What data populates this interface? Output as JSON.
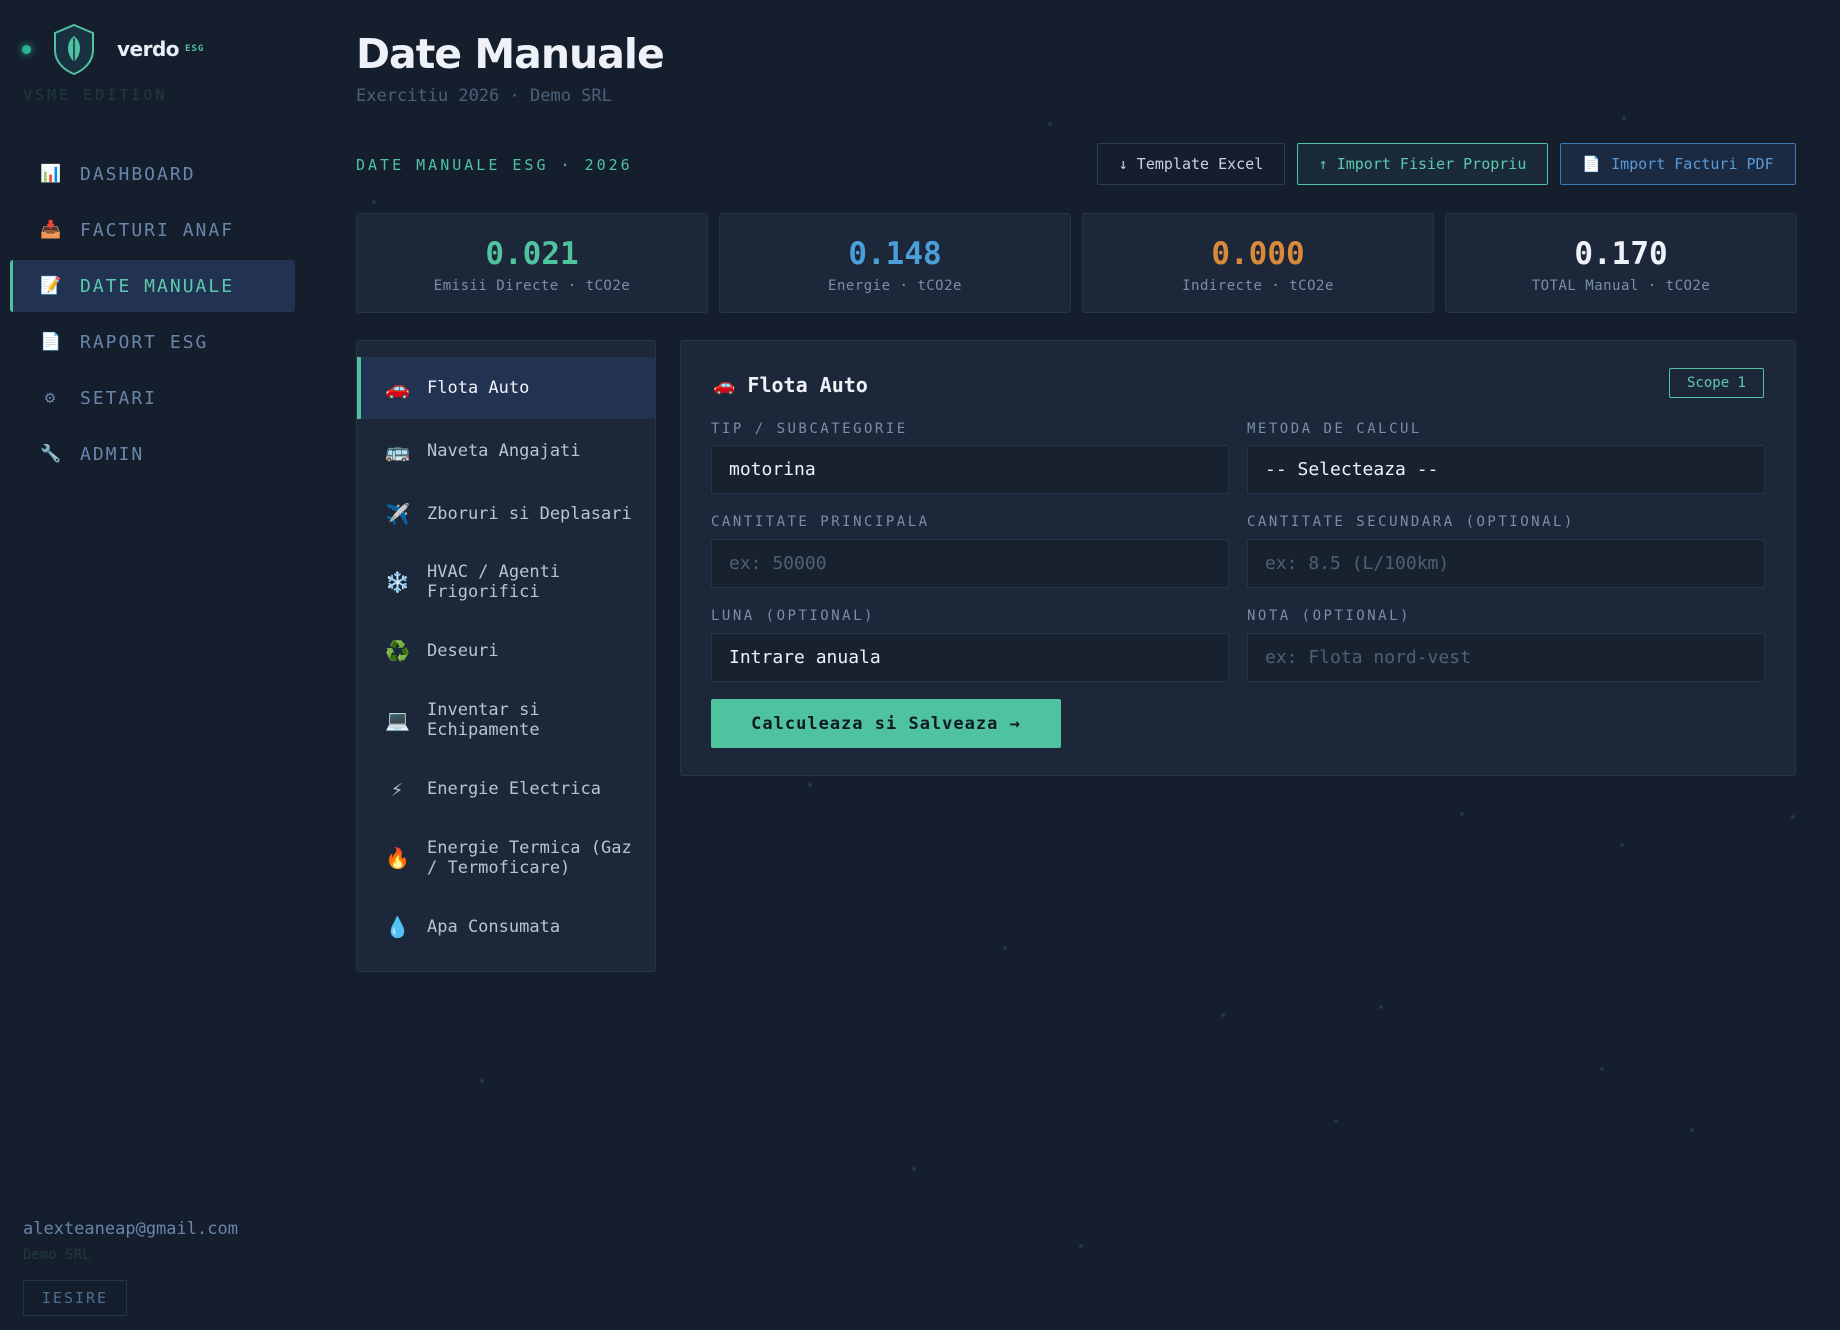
{
  "brand": {
    "name": "verdo",
    "sub": "ESG",
    "edition": "VSME EDITION"
  },
  "sidebar": {
    "items": [
      {
        "icon": "📊",
        "label": "DASHBOARD"
      },
      {
        "icon": "📥",
        "label": "FACTURI ANAF"
      },
      {
        "icon": "📝",
        "label": "DATE MANUALE"
      },
      {
        "icon": "📄",
        "label": "RAPORT ESG"
      },
      {
        "icon": "⚙",
        "label": "SETARI"
      },
      {
        "icon": "🔧",
        "label": "ADMIN"
      }
    ],
    "active_index": 2
  },
  "user": {
    "email": "alexteaneap@gmail.com",
    "company": "Demo SRL",
    "logout_label": "IESIRE"
  },
  "header": {
    "title": "Date Manuale",
    "subtitle": "Exercitiu 2026 · Demo SRL"
  },
  "section_label": "DATE MANUALE ESG · 2026",
  "actions": {
    "template_label": "↓ Template Excel",
    "import_label": "↑ Import Fisier Propriu",
    "pdf_icon": "📄",
    "pdf_label": "Import Facturi PDF"
  },
  "stats": [
    {
      "value": "0.021",
      "label": "Emisii Directe · tCO2e",
      "color": "#4fc2a0"
    },
    {
      "value": "0.148",
      "label": "Energie · tCO2e",
      "color": "#4a9fd8"
    },
    {
      "value": "0.000",
      "label": "Indirecte · tCO2e",
      "color": "#d8893a"
    },
    {
      "value": "0.170",
      "label": "TOTAL Manual · tCO2e",
      "color": "#eef2f8"
    }
  ],
  "categories": [
    {
      "icon": "🚗",
      "label": "Flota Auto"
    },
    {
      "icon": "🚌",
      "label": "Naveta Angajati"
    },
    {
      "icon": "✈️",
      "label": "Zboruri si Deplasari"
    },
    {
      "icon": "❄️",
      "label": "HVAC / Agenti Frigorifici"
    },
    {
      "icon": "♻️",
      "label": "Deseuri"
    },
    {
      "icon": "💻",
      "label": "Inventar si Echipamente"
    },
    {
      "icon": "⚡",
      "label": "Energie Electrica"
    },
    {
      "icon": "🔥",
      "label": "Energie Termica (Gaz / Termoficare)"
    },
    {
      "icon": "💧",
      "label": "Apa Consumata"
    }
  ],
  "form": {
    "icon": "🚗",
    "title": "Flota Auto",
    "scope": "Scope 1",
    "tip_label": "TIP / SUBCATEGORIE",
    "tip_value": "motorina",
    "metoda_label": "METODA DE CALCUL",
    "metoda_value": "-- Selecteaza --",
    "cant_principala_label": "CANTITATE PRINCIPALA",
    "cant_principala_placeholder": "ex: 50000",
    "cant_secundara_label": "CANTITATE SECUNDARA (OPTIONAL)",
    "cant_secundara_placeholder": "ex: 8.5 (L/100km)",
    "luna_label": "LUNA (OPTIONAL)",
    "luna_value": "Intrare anuala",
    "nota_label": "NOTA (OPTIONAL)",
    "nota_placeholder": "ex: Flota nord-vest",
    "submit_label": "Calculeaza si Salveaza →"
  }
}
